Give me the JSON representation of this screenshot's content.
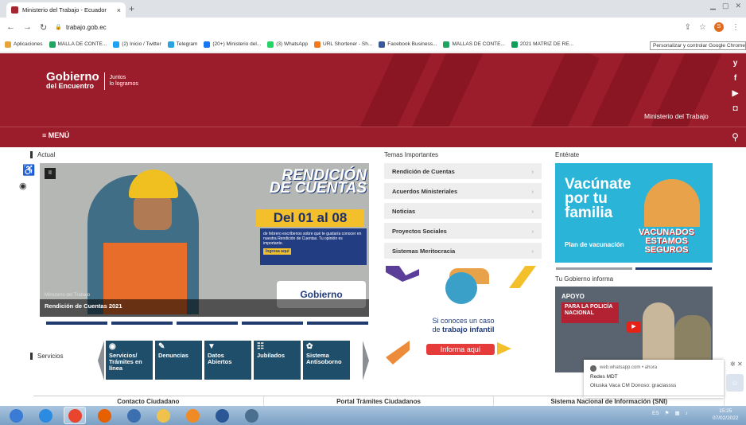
{
  "browser": {
    "tab_title": "Ministerio del Trabajo - Ecuador",
    "tab_close": "×",
    "new_tab": "+",
    "url": "trabajo.gob.ec",
    "bookmarks": [
      {
        "label": "Aplicaciones",
        "color": "#e8a33c"
      },
      {
        "label": "MALLA DE CONTE...",
        "color": "#1fa463"
      },
      {
        "label": "(2) Inicio / Twitter",
        "color": "#1da1f2"
      },
      {
        "label": "Telegram",
        "color": "#2aa3e0"
      },
      {
        "label": "(20+) Ministerio del...",
        "color": "#1877f2"
      },
      {
        "label": "(3) WhatsApp",
        "color": "#25d366"
      },
      {
        "label": "URL Shortener - Sh...",
        "color": "#f07a1d"
      },
      {
        "label": "Facebook Business...",
        "color": "#3b5998"
      },
      {
        "label": "MALLAS DE CONTE...",
        "color": "#1fa463"
      },
      {
        "label": "2021 MATRIZ DE RE...",
        "color": "#0f9d58"
      }
    ],
    "tooltip": "Personalizar y controlar Google Chrome",
    "profile_initial": "S"
  },
  "header": {
    "logo_main": "Gobierno",
    "logo_sub": "del Encuentro",
    "logo_tag1": "Juntos",
    "logo_tag2": "lo logramos",
    "ministry": "Ministerio del Trabajo",
    "menu": "≡ MENÚ",
    "social": [
      "y",
      "f",
      "▶",
      "◘"
    ]
  },
  "actual": {
    "label": "Actual",
    "banner_title": "RENDICIÓN DE CUENTAS",
    "banner_dates": "Del 01 al 08",
    "banner_text": "de febrero escríbenos sobre qué te gustaría conocer en nuestra Rendición de Cuentas. Tu opinión es importante.",
    "banner_cta": "Ingresa aquí",
    "caption_sub": "Ministerio del Trabajo",
    "caption": "Rendición de Cuentas 2021",
    "pause": "II"
  },
  "services": {
    "label": "Servicios",
    "items": [
      {
        "icon": "◉",
        "label": "Servicios/ Trámites en línea"
      },
      {
        "icon": "✎",
        "label": "Denuncias"
      },
      {
        "icon": "▼",
        "label": "Datos Abiertos"
      },
      {
        "icon": "☷",
        "label": "Jubilados"
      },
      {
        "icon": "✿",
        "label": "Sistema Antisoborno"
      }
    ]
  },
  "temas": {
    "label": "Temas Importantes",
    "items": [
      "Rendición de Cuentas",
      "Acuerdos Ministeriales",
      "Noticias",
      "Proyectos Sociales",
      "Sistemas Meritocracia"
    ]
  },
  "infantil": {
    "line1": "Si conoces un caso",
    "line2_pre": "de ",
    "line2_bold": "trabajo infantil",
    "button": "Informa aquí"
  },
  "enterate": {
    "label": "Entérate",
    "vac_title": "Vacúnate por tu familia",
    "vac_plan": "Plan de vacunación",
    "vac_badge": "VACUNADOS ESTAMOS SEGUROS"
  },
  "gobierno_informa": {
    "label": "Tu Gobierno informa",
    "headline": "APOYO",
    "band": "PARA LA POLICÍA NACIONAL"
  },
  "notification": {
    "source": "web.whatsapp.com • ahora",
    "title": "Redes MDT",
    "body": "Oliuska Vaca CM Donoso: graciassss"
  },
  "bottom_links": [
    "Contacto Ciudadano",
    "Portal Trámites Ciudadanos",
    "Sistema Nacional de Información (SNI)"
  ],
  "taskbar": {
    "apps": [
      {
        "name": "start",
        "color": "#3a7bd5"
      },
      {
        "name": "ie",
        "color": "#2a8be0"
      },
      {
        "name": "chrome",
        "color": "#e9442e"
      },
      {
        "name": "firefox",
        "color": "#e66000"
      },
      {
        "name": "app5",
        "color": "#3c6fb0"
      },
      {
        "name": "folder",
        "color": "#f0c24b"
      },
      {
        "name": "media",
        "color": "#f08a24"
      },
      {
        "name": "word",
        "color": "#2b5797"
      },
      {
        "name": "app9",
        "color": "#4a6f8f"
      }
    ],
    "lang": "ES",
    "time": "15:25",
    "date": "07/02/2022"
  }
}
